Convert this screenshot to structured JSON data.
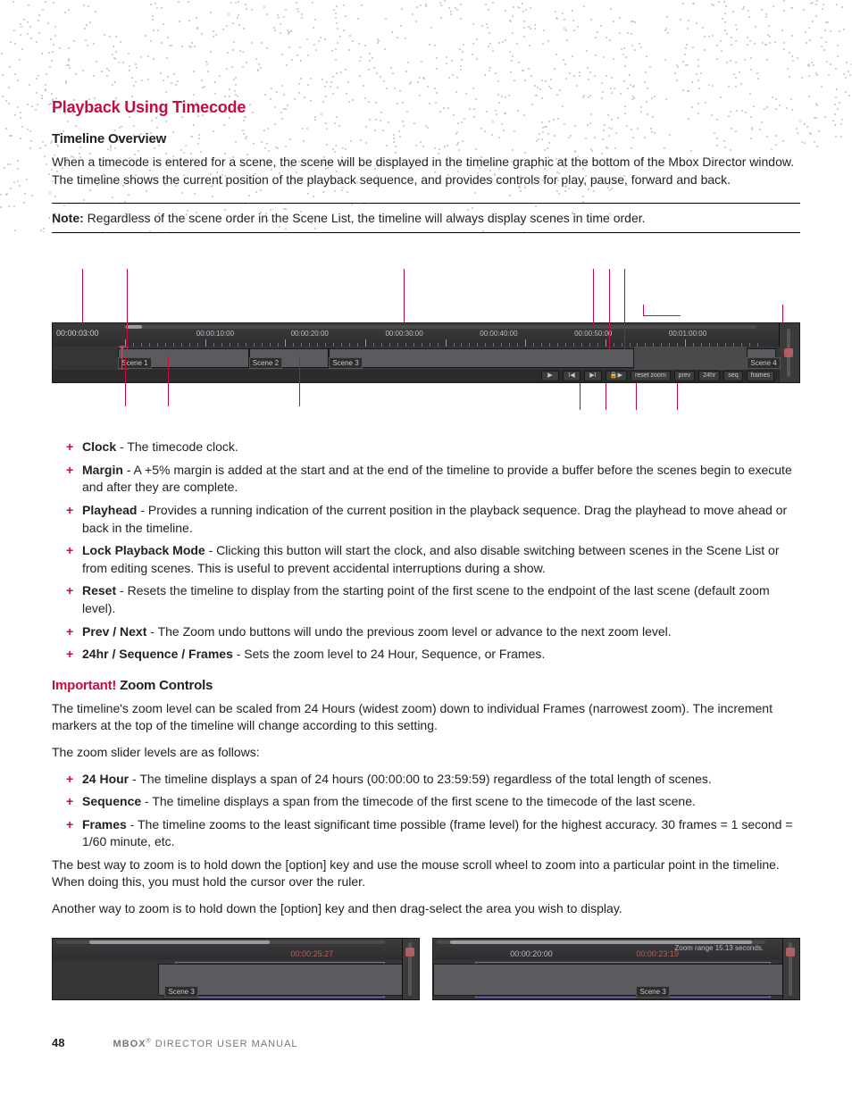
{
  "headings": {
    "section": "Playback Using Timecode",
    "sub1": "Timeline Overview",
    "sub2_important": "Important!",
    "sub2_rest": " Zoom Controls"
  },
  "paragraphs": {
    "overview": "When a timecode is entered for a scene, the scene will be displayed in the timeline graphic at the bottom of the Mbox Director window. The timeline shows the current position of the playback sequence, and provides controls for play, pause, forward and back.",
    "note_label": "Note:",
    "note_body": "  Regardless of the scene order in the Scene List, the timeline will always display scenes in time order.",
    "zoom_intro1": "The timeline's zoom level can be scaled from 24 Hours (widest zoom) down to individual Frames (narrowest zoom). The increment markers at the top of the timeline will change according to this setting.",
    "zoom_intro2": "The zoom slider levels are as follows:",
    "zoom_tip1": "The best way to zoom is to hold down the [option] key and use the mouse scroll wheel to zoom into a particular point in the timeline. When doing this, you must hold the cursor over the ruler.",
    "zoom_tip2": "Another way to zoom is to hold down the [option] key and then drag-select the area you wish to display."
  },
  "bullets_main": [
    {
      "b": "Clock",
      "t": " - The timecode clock."
    },
    {
      "b": "Margin",
      "t": " - A +5% margin is added at the start and at the end of the timeline to provide a buffer before the scenes begin to execute and after they are complete."
    },
    {
      "b": "Playhead",
      "t": " - Provides a running indication of the current position in the playback sequence. Drag the playhead to move ahead or back in the timeline."
    },
    {
      "b": "Lock Playback Mode",
      "t": " - Clicking this button will start the clock, and also disable switching between scenes in the Scene List or from editing scenes. This is useful to prevent accidental interruptions during a show."
    },
    {
      "b": "Reset",
      "t": " - Resets the timeline to display from the starting point of the first scene to the endpoint of the last scene (default zoom level)."
    },
    {
      "b": "Prev / Next",
      "t": " - The Zoom undo buttons will undo the previous zoom level or advance to the next zoom level."
    },
    {
      "b": "24hr / Sequence / Frames",
      "t": " - Sets the zoom level to 24 Hour, Sequence, or Frames."
    }
  ],
  "bullets_zoom": [
    {
      "b": "24 Hour",
      "t": " - The timeline displays a span of 24 hours (00:00:00 to 23:59:59) regardless of the total length of scenes."
    },
    {
      "b": "Sequence",
      "t": " - The timeline displays a span from the timecode of the first scene to the timecode of the last scene."
    },
    {
      "b": "Frames",
      "t": " - The timeline zooms to the least significant time possible (frame level) for the highest accuracy. 30 frames = 1 second = 1/60 minute, etc."
    }
  ],
  "timeline_main": {
    "clock": "00:00:03:00",
    "tick_labels": [
      "00:00:10:00",
      "00:00:20:00",
      "00:00:30:00",
      "00:00:40:00",
      "00:00:50:00",
      "00:01:00:00"
    ],
    "scenes": [
      {
        "label": "Scene 1",
        "left_pct": 9,
        "width_pct": 18
      },
      {
        "label": "Scene 2",
        "left_pct": 27,
        "width_pct": 11
      },
      {
        "label": "Scene 3",
        "left_pct": 38,
        "width_pct": 42
      },
      {
        "label": "Scene 4",
        "left_pct": 95.5,
        "width_pct": 4
      }
    ],
    "margins": [
      {
        "left_pct": 9,
        "width_pct": 1.5
      },
      {
        "left_pct": 80,
        "width_pct": 15.5
      }
    ],
    "playhead_pct": 9.5,
    "buttons": {
      "play": "▶",
      "begin": "I◀",
      "end": "▶I",
      "lock": "🔒▶",
      "reset": "reset zoom",
      "prev": "prev",
      "hr24": "24hr",
      "seq": "seq",
      "frames": "frames"
    }
  },
  "small_left": {
    "tc_playhead": "00:00:25:27",
    "scene_label": "Scene 3",
    "thumb_left_pct": 10,
    "thumb_w_pct": 55,
    "ph_pos_pct": 82
  },
  "small_right": {
    "tc_ruler": "00:00:20:00",
    "tc_playhead": "00:00:23:19",
    "zoom_range": "Zoom range 15.13 seconds.",
    "scene_label": "Scene 3",
    "thumb_left_pct": 4,
    "thumb_w_pct": 92,
    "ph_pos_pct": 72,
    "sel_left_pct": 12,
    "sel_w_pct": 84
  },
  "footer": {
    "page": "48",
    "product": "MBOX",
    "reg": "®",
    "rest": " DIRECTOR USER MANUAL"
  }
}
